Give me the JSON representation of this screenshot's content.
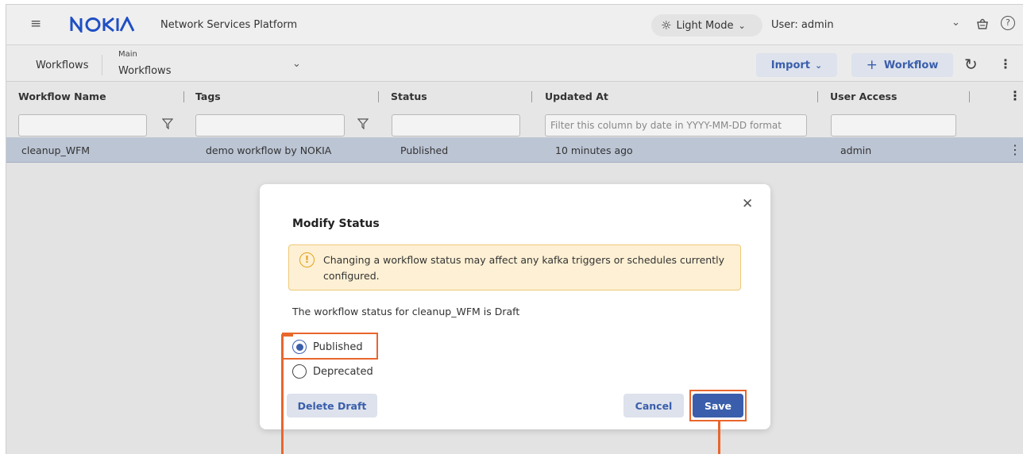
{
  "header": {
    "logo_text": "NOKIA",
    "app_title": "Network Services Platform",
    "light_mode_label": "Light Mode",
    "user_label": "User: admin"
  },
  "toolbar": {
    "breadcrumb_workflows": "Workflows",
    "breadcrumb_main_label": "Main",
    "breadcrumb_main_value": "Workflows",
    "import_label": "Import",
    "add_workflow_label": "Workflow"
  },
  "table": {
    "columns": [
      "Workflow Name",
      "Tags",
      "Status",
      "Updated At",
      "User Access"
    ],
    "date_filter_placeholder": "Filter this column by date in YYYY-MM-DD format",
    "rows": [
      {
        "name": "cleanup_WFM",
        "tags": "demo workflow by NOKIA",
        "status": "Published",
        "updated": "10 minutes ago",
        "access": "admin"
      }
    ]
  },
  "modal": {
    "title": "Modify Status",
    "warning": "Changing a workflow status may affect any kafka triggers or schedules currently configured.",
    "status_line": "The workflow status for cleanup_WFM is Draft",
    "options": [
      {
        "label": "Published",
        "selected": true
      },
      {
        "label": "Deprecated",
        "selected": false
      }
    ],
    "delete_draft_label": "Delete Draft",
    "cancel_label": "Cancel",
    "save_label": "Save"
  },
  "colors": {
    "brand_blue": "#3a5eab",
    "highlight_orange": "#e9662c",
    "warning_bg": "#fdf0d4"
  }
}
